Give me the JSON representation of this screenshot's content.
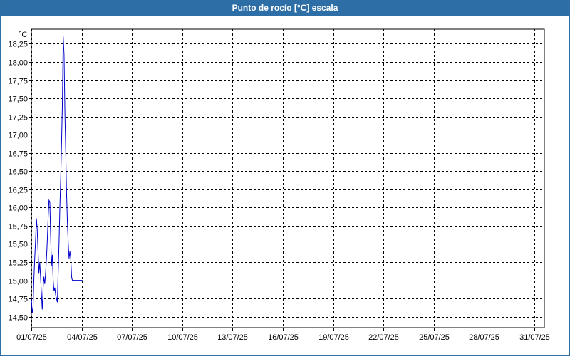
{
  "window": {
    "title": "Punto de rocío [°C] escala"
  },
  "chart_data": {
    "type": "line",
    "title": "Punto de rocío [°C] escala",
    "ylabel": "°C",
    "xlabel": "",
    "ylim": [
      14.35,
      18.45
    ],
    "xlim": [
      0,
      30.6
    ],
    "grid": true,
    "y_ticks": [
      {
        "value": 14.5,
        "label": "14,50"
      },
      {
        "value": 14.75,
        "label": "14,75"
      },
      {
        "value": 15.0,
        "label": "15,00"
      },
      {
        "value": 15.25,
        "label": "15,25"
      },
      {
        "value": 15.5,
        "label": "15,50"
      },
      {
        "value": 15.75,
        "label": "15,75"
      },
      {
        "value": 16.0,
        "label": "16,00"
      },
      {
        "value": 16.25,
        "label": "16,25"
      },
      {
        "value": 16.5,
        "label": "16,50"
      },
      {
        "value": 16.75,
        "label": "16,75"
      },
      {
        "value": 17.0,
        "label": "17,00"
      },
      {
        "value": 17.25,
        "label": "17,25"
      },
      {
        "value": 17.5,
        "label": "17,50"
      },
      {
        "value": 17.75,
        "label": "17,75"
      },
      {
        "value": 18.0,
        "label": "18,00"
      },
      {
        "value": 18.25,
        "label": "18,25"
      }
    ],
    "x_ticks": [
      {
        "value": 0,
        "label": "01/07/25"
      },
      {
        "value": 3,
        "label": "04/07/25"
      },
      {
        "value": 6,
        "label": "07/07/25"
      },
      {
        "value": 9,
        "label": "10/07/25"
      },
      {
        "value": 12,
        "label": "13/07/25"
      },
      {
        "value": 15,
        "label": "16/07/25"
      },
      {
        "value": 18,
        "label": "19/07/25"
      },
      {
        "value": 21,
        "label": "22/07/25"
      },
      {
        "value": 24,
        "label": "25/07/25"
      },
      {
        "value": 27,
        "label": "28/07/25"
      },
      {
        "value": 30,
        "label": "31/07/25"
      }
    ],
    "series": [
      {
        "color": "#0000cc",
        "x": [
          0.0,
          0.05,
          0.1,
          0.15,
          0.2,
          0.25,
          0.3,
          0.35,
          0.4,
          0.45,
          0.5,
          0.55,
          0.6,
          0.65,
          0.7,
          0.75,
          0.8,
          0.85,
          0.9,
          0.95,
          1.0,
          1.05,
          1.1,
          1.15,
          1.2,
          1.25,
          1.3,
          1.35,
          1.4,
          1.45,
          1.5,
          1.55,
          1.6,
          1.65,
          1.7,
          1.75,
          1.8,
          1.85,
          1.9,
          1.95,
          2.0,
          2.05,
          2.1,
          2.15,
          2.2,
          2.25,
          2.3,
          2.35,
          2.4,
          2.45,
          2.5,
          2.55,
          2.6,
          2.65,
          2.7,
          2.75,
          2.8,
          2.85,
          2.9,
          2.95,
          3.0,
          3.05
        ],
        "values": [
          14.75,
          14.55,
          14.62,
          15.0,
          15.3,
          15.55,
          15.85,
          15.7,
          15.4,
          15.1,
          15.25,
          15.05,
          14.82,
          14.6,
          14.9,
          15.05,
          14.95,
          15.1,
          15.3,
          15.55,
          15.85,
          16.1,
          16.08,
          15.6,
          15.2,
          15.35,
          15.0,
          14.85,
          14.9,
          14.8,
          14.75,
          14.7,
          15.1,
          15.5,
          16.0,
          16.4,
          16.9,
          17.4,
          18.35,
          18.1,
          17.3,
          16.8,
          16.2,
          15.8,
          15.5,
          15.3,
          15.4,
          15.3,
          15.05,
          15.0,
          15.0,
          15.0,
          15.0,
          15.0,
          15.0,
          15.0,
          15.0,
          15.0,
          15.0,
          15.0,
          15.0,
          15.0
        ]
      }
    ]
  }
}
